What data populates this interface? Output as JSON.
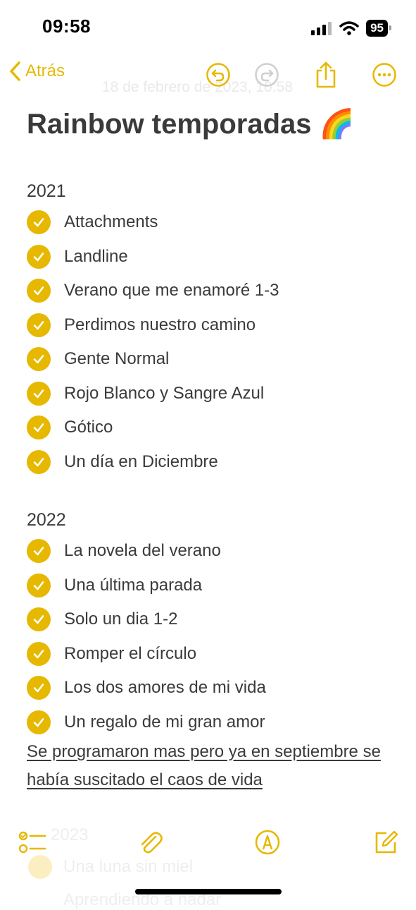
{
  "status_bar": {
    "time": "09:58",
    "battery": "95"
  },
  "nav": {
    "back_label": "Atrás",
    "ghost_date": "18 de febrero de 2023, 10:58"
  },
  "note": {
    "title": "Rainbow temporadas",
    "title_emoji": "🌈",
    "sections": [
      {
        "year": "2021",
        "items": [
          "Attachments",
          "Landline",
          "Verano que me enamoré 1-3",
          "Perdimos nuestro camino",
          "Gente Normal",
          "Rojo Blanco y Sangre Azul",
          "Gótico",
          "Un día en Diciembre"
        ]
      },
      {
        "year": "2022",
        "items": [
          "La novela del verano",
          "Una última parada",
          "Solo un dia 1-2",
          "Romper el círculo",
          "Los dos amores de mi vida",
          "Un regalo de mi gran amor"
        ]
      }
    ],
    "underlined_note": "Se programaron mas pero ya en septiembre se había suscitado el caos de vida",
    "faded_year": "2023",
    "faded_item": "Una luna sin miel",
    "faded_item2": "Aprendiendo a nadar"
  },
  "colors": {
    "accent": "#e6b800",
    "text": "#3a3a3c"
  },
  "icons": {
    "back": "chevron-left-icon",
    "undo": "undo-icon",
    "redo": "redo-icon",
    "share": "share-icon",
    "more": "more-icon",
    "checklist": "checklist-icon",
    "attach": "paperclip-icon",
    "markup": "markup-pen-icon",
    "compose": "compose-icon"
  }
}
